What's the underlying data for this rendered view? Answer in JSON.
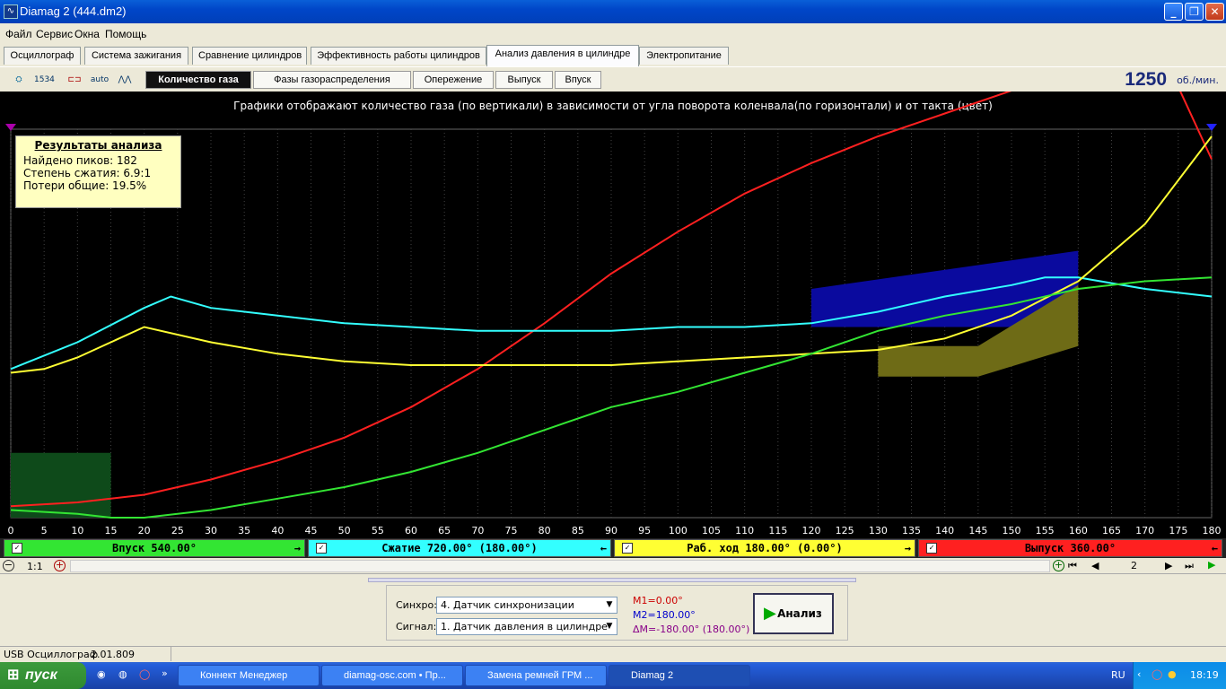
{
  "window": {
    "title": "Diamag 2 (444.dm2)",
    "app_icon": "waveform-icon",
    "min": "_",
    "max": "❐",
    "close": "✕"
  },
  "menu": [
    "Файл",
    "Сервис",
    "Окна",
    "Помощь"
  ],
  "tabs": [
    "Осциллограф",
    "Система зажигания",
    "Сравнение цилиндров",
    "Эффективность работы цилиндров",
    "Анализ давления в цилиндре",
    "Электропитание"
  ],
  "toolbar": {
    "icons": [
      "cylinder-icon",
      "sync-icon",
      "markers-icon",
      "auto-scale-icon",
      "waveform-tool-icon"
    ],
    "icon_text": [
      "",
      "1534",
      "",
      "auto",
      ""
    ],
    "subtabs": [
      "Количество газа",
      "Фазы газораспределения",
      "Опережение",
      "Выпуск",
      "Впуск"
    ],
    "rpm": "1250",
    "rpm_unit": "об./мин."
  },
  "plot": {
    "title": "Графики отображают количество газа (по вертикали) в зависимости от угла поворота коленвала(по горизонтали) и от такта (цвет)"
  },
  "results": {
    "title": "Результаты анализа",
    "peaks": "Найдено пиков: 182",
    "compression": "Степень сжатия: 6.9:1",
    "losses": "Потери общие: 19.5%"
  },
  "strokes": [
    {
      "label": "Впуск 540.00°",
      "color": "#33e533",
      "arrow": "→"
    },
    {
      "label": "Сжатие 720.00° (180.00°)",
      "color": "#33ffff",
      "arrow": "←"
    },
    {
      "label": "Раб. ход 180.00° (0.00°)",
      "color": "#ffff33",
      "arrow": "→"
    },
    {
      "label": "Выпуск 360.00°",
      "color": "#ff2020",
      "arrow": "←"
    }
  ],
  "nav": {
    "zoom": "1:1",
    "page": "2"
  },
  "bottom": {
    "sync_label": "Синхро:",
    "sync_value": "4.  Датчик синхронизации",
    "signal_label": "Сигнал:",
    "signal_value": "1.  Датчик давления в цилиндре",
    "m1": "M1=0.00°",
    "m2": "M2=180.00°",
    "dm": "ΔM=-180.00° (180.00°)",
    "analyze": "Анализ"
  },
  "status": {
    "device": "USB Осциллограф",
    "version": "2.01.809"
  },
  "taskbar": {
    "start": "пуск",
    "tasks": [
      "Коннект Менеджер",
      "diamag-osc.com • Пр...",
      "Замена ремней ГРМ ...",
      "Diamag 2"
    ],
    "lang": "RU",
    "time": "18:19"
  },
  "chart_data": {
    "type": "line",
    "title": "Графики отображают количество газа (по вертикали) в зависимости от угла поворота коленвала(по горизонтали) и от такта (цвет)",
    "xlabel": "",
    "ylabel": "",
    "xlim": [
      0,
      180
    ],
    "ylim": [
      0,
      100
    ],
    "x_ticks": [
      0,
      5,
      10,
      15,
      20,
      25,
      30,
      35,
      40,
      45,
      50,
      55,
      60,
      65,
      70,
      75,
      80,
      85,
      90,
      95,
      100,
      105,
      110,
      115,
      120,
      125,
      130,
      135,
      140,
      145,
      150,
      155,
      160,
      165,
      170,
      175,
      180
    ],
    "grid": "vertical",
    "series": [
      {
        "name": "Выпуск",
        "color": "#ff2020",
        "x": [
          0,
          10,
          20,
          30,
          40,
          50,
          60,
          70,
          80,
          90,
          100,
          110,
          120,
          130,
          140,
          150,
          160,
          165,
          170,
          175,
          180
        ],
        "y": [
          3,
          4,
          6,
          10,
          15,
          21,
          29,
          39,
          51,
          64,
          75,
          85,
          93,
          100,
          106,
          112,
          117,
          118,
          118,
          113,
          94
        ]
      },
      {
        "name": "Сжатие",
        "color": "#33ffff",
        "x": [
          0,
          10,
          20,
          24,
          30,
          40,
          50,
          60,
          70,
          80,
          90,
          100,
          110,
          120,
          130,
          140,
          150,
          155,
          160,
          170,
          180
        ],
        "y": [
          39,
          46,
          55,
          58,
          55,
          53,
          51,
          50,
          49,
          49,
          49,
          50,
          50,
          51,
          54,
          58,
          61,
          63,
          63,
          60,
          58
        ]
      },
      {
        "name": "Раб. ход",
        "color": "#ffff33",
        "x": [
          0,
          5,
          10,
          15,
          20,
          30,
          40,
          50,
          60,
          70,
          80,
          90,
          100,
          110,
          120,
          130,
          140,
          150,
          160,
          170,
          180
        ],
        "y": [
          38,
          39,
          42,
          46,
          50,
          46,
          43,
          41,
          40,
          40,
          40,
          40,
          41,
          42,
          43,
          44,
          47,
          53,
          62,
          77,
          100
        ]
      },
      {
        "name": "Впуск",
        "color": "#33e533",
        "x": [
          0,
          10,
          15,
          20,
          30,
          40,
          50,
          60,
          70,
          80,
          90,
          100,
          110,
          120,
          130,
          140,
          150,
          160,
          170,
          180
        ],
        "y": [
          2,
          1,
          0,
          0,
          2,
          5,
          8,
          12,
          17,
          23,
          29,
          33,
          38,
          43,
          49,
          53,
          56,
          60,
          62,
          63
        ]
      }
    ],
    "bands": [
      {
        "color": "#0a0a9e",
        "x": [
          120,
          160
        ]
      },
      {
        "color": "#6e6b16",
        "x": [
          130,
          160
        ]
      },
      {
        "color": "#0e4a1a",
        "x": [
          0,
          15
        ]
      }
    ]
  }
}
